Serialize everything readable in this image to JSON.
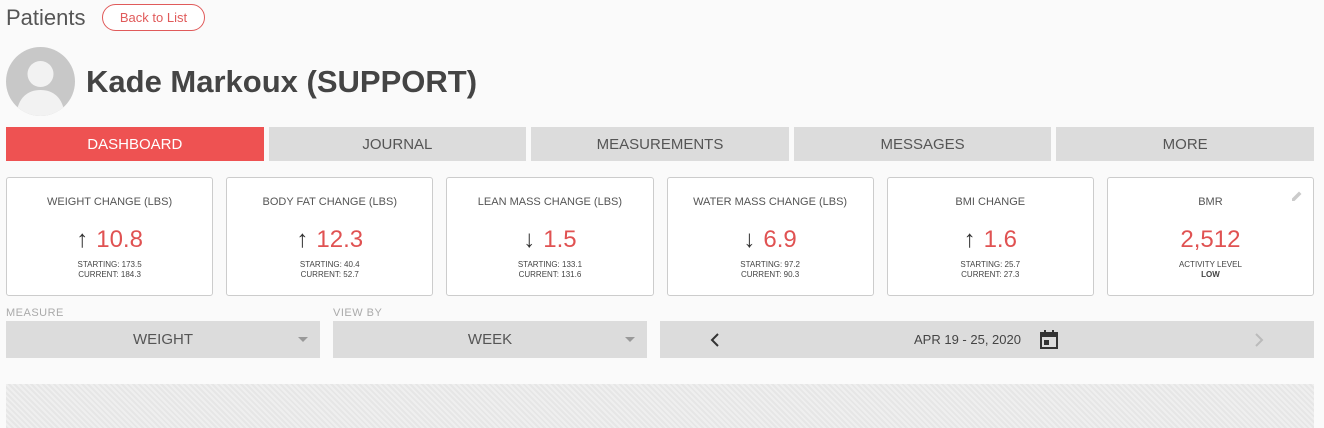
{
  "header": {
    "title": "Patients",
    "back_label": "Back to List"
  },
  "patient": {
    "name": "Kade Markoux (SUPPORT)"
  },
  "tabs": [
    {
      "label": "DASHBOARD",
      "active": true
    },
    {
      "label": "JOURNAL",
      "active": false
    },
    {
      "label": "MEASUREMENTS",
      "active": false
    },
    {
      "label": "MESSAGES",
      "active": false
    },
    {
      "label": "MORE",
      "active": false
    }
  ],
  "cards": [
    {
      "label": "WEIGHT CHANGE (LBS)",
      "arrow": "up",
      "value": "10.8",
      "line1": "STARTING: 173.5",
      "line2": "CURRENT: 184.3"
    },
    {
      "label": "BODY FAT CHANGE (LBS)",
      "arrow": "up",
      "value": "12.3",
      "line1": "STARTING: 40.4",
      "line2": "CURRENT: 52.7"
    },
    {
      "label": "LEAN MASS CHANGE (LBS)",
      "arrow": "down",
      "value": "1.5",
      "line1": "STARTING: 133.1",
      "line2": "CURRENT: 131.6"
    },
    {
      "label": "WATER MASS CHANGE (LBS)",
      "arrow": "down",
      "value": "6.9",
      "line1": "STARTING: 97.2",
      "line2": "CURRENT: 90.3"
    },
    {
      "label": "BMI CHANGE",
      "arrow": "up",
      "value": "1.6",
      "line1": "STARTING: 25.7",
      "line2": "CURRENT: 27.3"
    },
    {
      "label": "BMR",
      "arrow": "",
      "value": "2,512",
      "line1": "ACTIVITY LEVEL",
      "line2": "LOW"
    }
  ],
  "filters": {
    "measure_label": "MEASURE",
    "measure_value": "WEIGHT",
    "viewby_label": "VIEW BY",
    "viewby_value": "WEEK",
    "date_range": "APR 19 - 25, 2020"
  },
  "colors": {
    "accent": "#ee5252",
    "tab_bg": "#dcdcdc"
  }
}
